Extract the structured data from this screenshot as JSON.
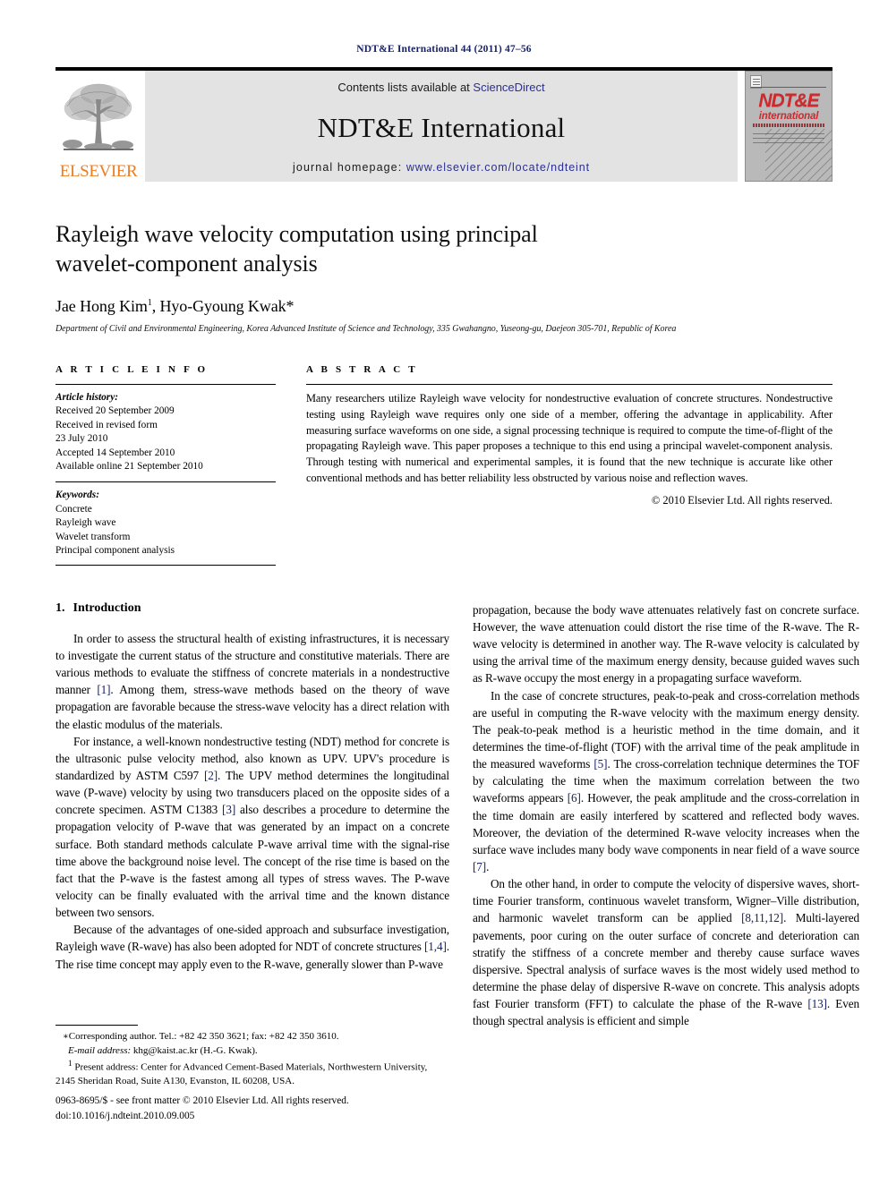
{
  "running_head": "NDT&E International 44 (2011) 47–56",
  "masthead": {
    "contents_prefix": "Contents lists available at ",
    "sciencedirect": "ScienceDirect",
    "journal_name": "NDT&E International",
    "homepage_prefix": "journal homepage: ",
    "homepage_url": "www.elsevier.com/locate/ndteint",
    "publisher_logo_text": "ELSEVIER",
    "cover": {
      "title": "NDT&E",
      "subtitle": "international"
    },
    "colors": {
      "band_background": "#e3e3e3",
      "link_blue": "#2b2f8f",
      "elsevier_orange": "#ec7d23",
      "cover_red": "#d3272c",
      "running_head_navy": "#16216b"
    }
  },
  "article": {
    "title_line1": "Rayleigh wave velocity computation using principal",
    "title_line2": "wavelet-component analysis",
    "authors": "Jae Hong Kim",
    "author1_sup": "1",
    "authors_cont": ", Hyo-Gyoung Kwak",
    "corresponding_mark": "*",
    "affiliation": "Department of Civil and Environmental Engineering, Korea Advanced Institute of Science and Technology, 335 Gwahangno, Yuseong-gu, Daejeon 305-701, Republic of Korea"
  },
  "article_info": {
    "heading": "A R T I C L E   I N F O",
    "history_label": "Article history:",
    "history": [
      "Received 20 September 2009",
      "Received in revised form",
      "23 July 2010",
      "Accepted 14 September 2010",
      "Available online 21 September 2010"
    ],
    "keywords_label": "Keywords:",
    "keywords": [
      "Concrete",
      "Rayleigh wave",
      "Wavelet transform",
      "Principal component analysis"
    ]
  },
  "abstract": {
    "heading": "A B S T R A C T",
    "text": "Many researchers utilize Rayleigh wave velocity for nondestructive evaluation of concrete structures. Nondestructive testing using Rayleigh wave requires only one side of a member, offering the advantage in applicability. After measuring surface waveforms on one side, a signal processing technique is required to compute the time-of-flight of the propagating Rayleigh wave. This paper proposes a technique to this end using a principal wavelet-component analysis. Through testing with numerical and experimental samples, it is found that the new technique is accurate like other conventional methods and has better reliability less obstructed by various noise and reflection waves.",
    "copyright": "© 2010 Elsevier Ltd. All rights reserved."
  },
  "body": {
    "section_number": "1.",
    "section_title": "Introduction",
    "left_paragraphs": [
      "In order to assess the structural health of existing infrastructures, it is necessary to investigate the current status of the structure and constitutive materials. There are various methods to evaluate the stiffness of concrete materials in a nondestructive manner [1]. Among them, stress-wave methods based on the theory of wave propagation are favorable because the stress-wave velocity has a direct relation with the elastic modulus of the materials.",
      "For instance, a well-known nondestructive testing (NDT) method for concrete is the ultrasonic pulse velocity method, also known as UPV. UPV's procedure is standardized by ASTM C597 [2]. The UPV method determines the longitudinal wave (P-wave) velocity by using two transducers placed on the opposite sides of a concrete specimen. ASTM C1383 [3] also describes a procedure to determine the propagation velocity of P-wave that was generated by an impact on a concrete surface. Both standard methods calculate P-wave arrival time with the signal-rise time above the background noise level. The concept of the rise time is based on the fact that the P-wave is the fastest among all types of stress waves. The P-wave velocity can be finally evaluated with the arrival time and the known distance between two sensors.",
      "Because of the advantages of one-sided approach and subsurface investigation, Rayleigh wave (R-wave) has also been adopted for NDT of concrete structures [1,4]. The rise time concept may apply even to the R-wave, generally slower than P-wave"
    ],
    "right_paragraphs": [
      "propagation, because the body wave attenuates relatively fast on concrete surface. However, the wave attenuation could distort the rise time of the R-wave. The R-wave velocity is determined in another way. The R-wave velocity is calculated by using the arrival time of the maximum energy density, because guided waves such as R-wave occupy the most energy in a propagating surface waveform.",
      "In the case of concrete structures, peak-to-peak and cross-correlation methods are useful in computing the R-wave velocity with the maximum energy density. The peak-to-peak method is a heuristic method in the time domain, and it determines the time-of-flight (TOF) with the arrival time of the peak amplitude in the measured waveforms [5]. The cross-correlation technique determines the TOF by calculating the time when the maximum correlation between the two waveforms appears [6]. However, the peak amplitude and the cross-correlation in the time domain are easily interfered by scattered and reflected body waves. Moreover, the deviation of the determined R-wave velocity increases when the surface wave includes many body wave components in near field of a wave source [7].",
      "On the other hand, in order to compute the velocity of dispersive waves, short-time Fourier transform, continuous wavelet transform, Wigner–Ville distribution, and harmonic wavelet transform can be applied [8,11,12]. Multi-layered pavements, poor curing on the outer surface of concrete and deterioration can stratify the stiffness of a concrete member and thereby cause surface waves dispersive. Spectral analysis of surface waves is the most widely used method to determine the phase delay of dispersive R-wave on concrete. This analysis adopts fast Fourier transform (FFT) to calculate the phase of the R-wave [13]. Even though spectral analysis is efficient and simple"
    ]
  },
  "footnotes": {
    "corresponding": "Corresponding author. Tel.: +82 42 350 3621; fax: +82 42 350 3610.",
    "email_label": "E-mail address:",
    "email_value": "khg@kaist.ac.kr (H.-G. Kwak).",
    "present_address_sup": "1",
    "present_address": "Present address: Center for Advanced Cement-Based Materials, Northwestern University, 2145 Sheridan Road, Suite A130, Evanston, IL 60208, USA."
  },
  "imprint": {
    "issn_line": "0963-8695/$ - see front matter © 2010 Elsevier Ltd. All rights reserved.",
    "doi_line": "doi:10.1016/j.ndteint.2010.09.005"
  }
}
